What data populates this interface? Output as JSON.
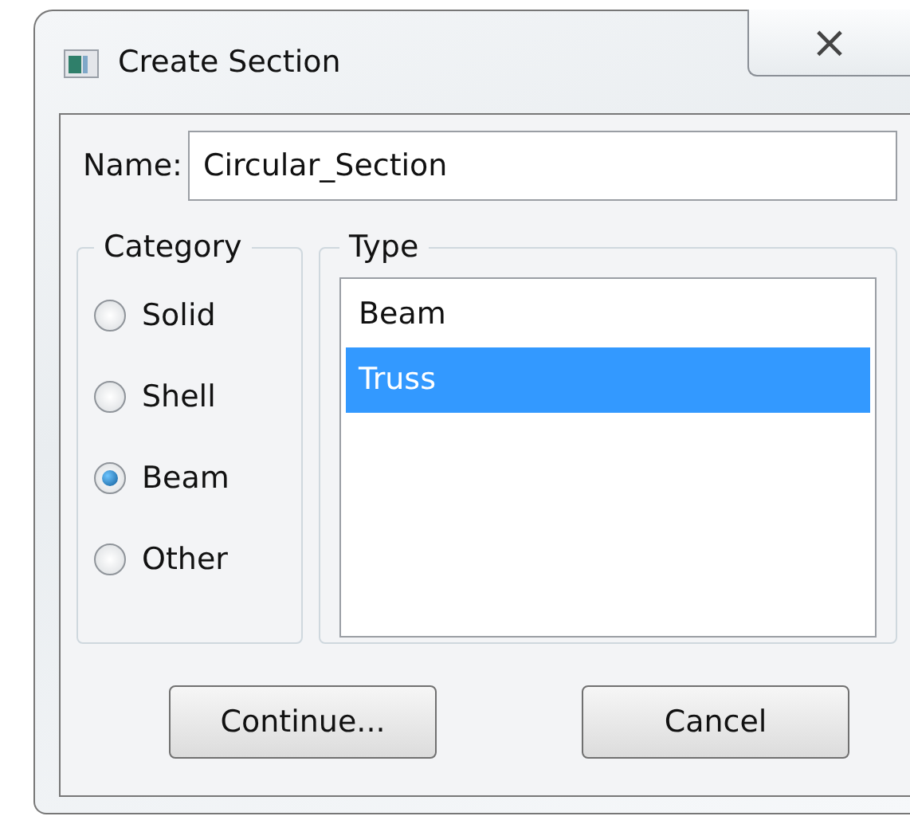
{
  "window": {
    "title": "Create Section",
    "close": "×"
  },
  "name": {
    "label": "Name:",
    "value": "Circular_Section"
  },
  "category": {
    "title": "Category",
    "options": [
      {
        "label": "Solid",
        "selected": false
      },
      {
        "label": "Shell",
        "selected": false
      },
      {
        "label": "Beam",
        "selected": true
      },
      {
        "label": "Other",
        "selected": false
      }
    ]
  },
  "type": {
    "title": "Type",
    "items": [
      {
        "label": "Beam",
        "selected": false
      },
      {
        "label": "Truss",
        "selected": true
      }
    ]
  },
  "buttons": [
    "Continue...",
    "Cancel"
  ]
}
